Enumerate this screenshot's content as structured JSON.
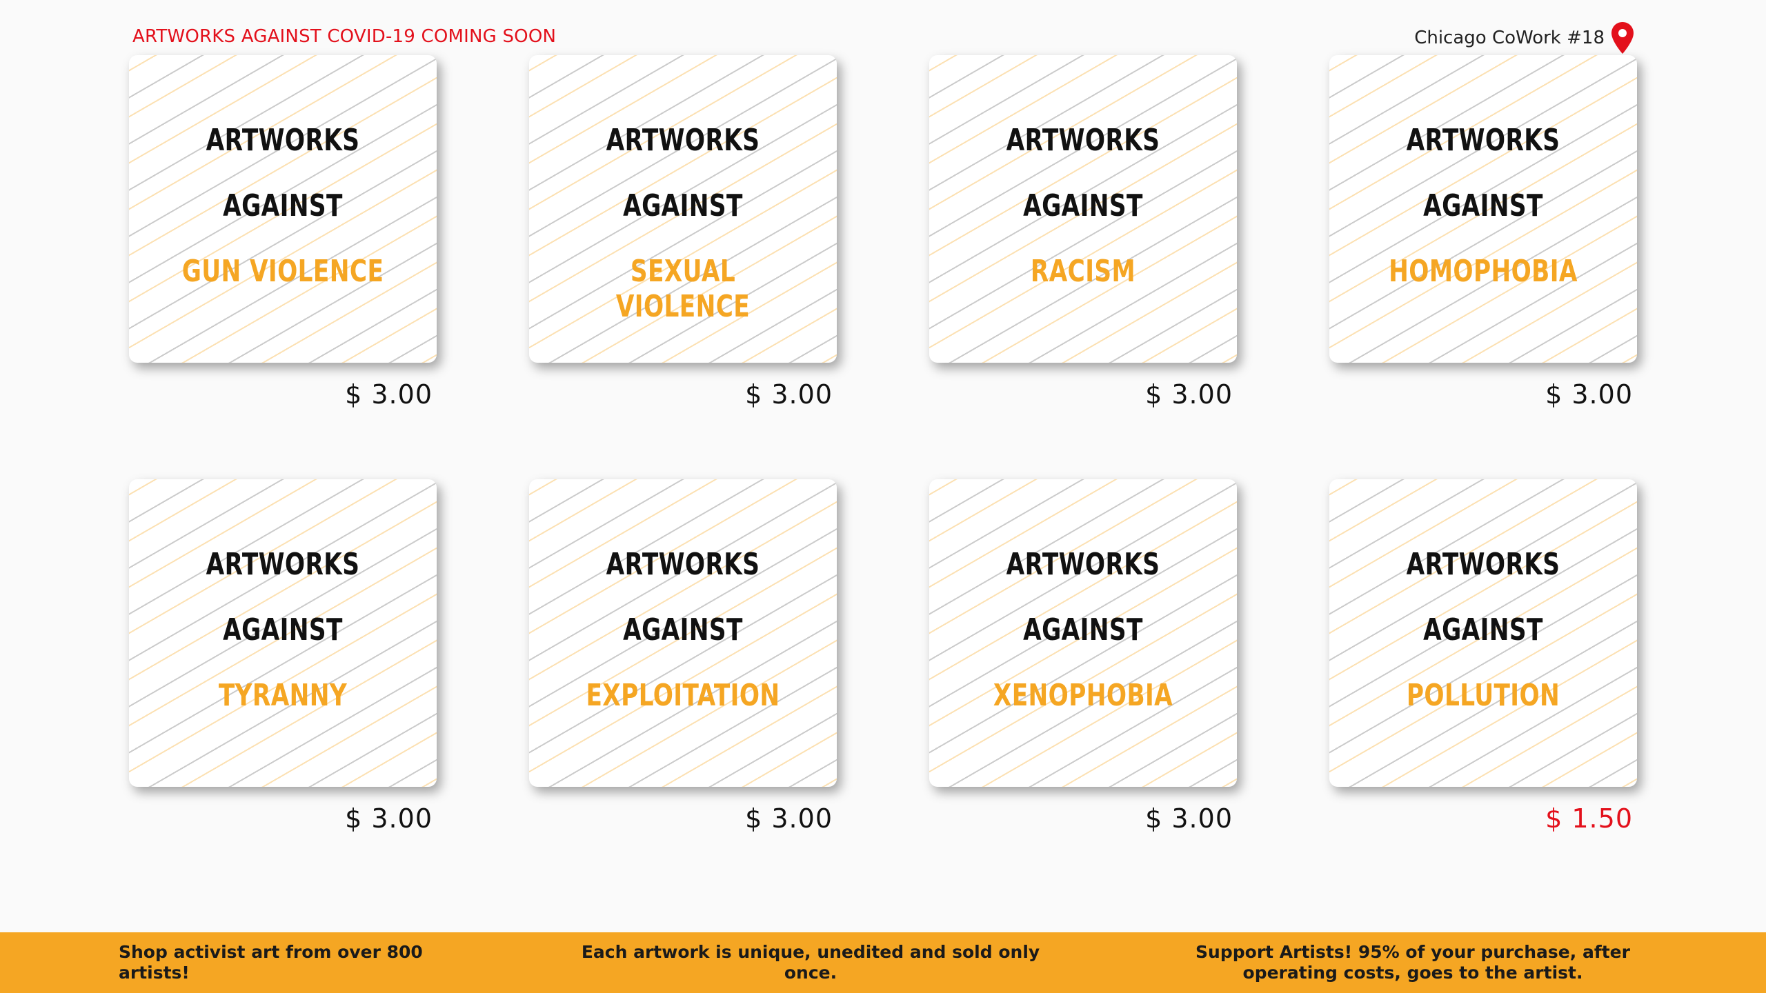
{
  "header": {
    "notice": "ARTWORKS AGAINST COVID-19 COMING SOON",
    "location": "Chicago CoWork #18",
    "location_icon": "map-pin-icon",
    "location_icon_color": "#e3101b"
  },
  "colors": {
    "accent": "#f5a623",
    "notice": "#e3101b",
    "sale_price": "#e3101b"
  },
  "products": [
    {
      "line1": "ARTWORKS",
      "line2": "AGAINST",
      "line3": "GUN VIOLENCE",
      "price": "$ 3.00"
    },
    {
      "line1": "ARTWORKS",
      "line2": "AGAINST",
      "line3": "SEXUAL VIOLENCE",
      "price": "$ 3.00"
    },
    {
      "line1": "ARTWORKS",
      "line2": "AGAINST",
      "line3": "RACISM",
      "price": "$ 3.00"
    },
    {
      "line1": "ARTWORKS",
      "line2": "AGAINST",
      "line3": "HOMOPHOBIA",
      "price": "$ 3.00"
    },
    {
      "line1": "ARTWORKS",
      "line2": "AGAINST",
      "line3": "TYRANNY",
      "price": "$ 3.00"
    },
    {
      "line1": "ARTWORKS",
      "line2": "AGAINST",
      "line3": "EXPLOITATION",
      "price": "$ 3.00"
    },
    {
      "line1": "ARTWORKS",
      "line2": "AGAINST",
      "line3": "XENOPHOBIA",
      "price": "$ 3.00"
    },
    {
      "line1": "ARTWORKS",
      "line2": "AGAINST",
      "line3": "POLLUTION",
      "price": "$ 1.50"
    }
  ],
  "footer": {
    "item1": "Shop activist art from over 800 artists!",
    "item2": "Each artwork is unique, unedited and sold only once.",
    "item3": "Support Artists! 95% of your purchase, after operating costs, goes to the artist."
  }
}
